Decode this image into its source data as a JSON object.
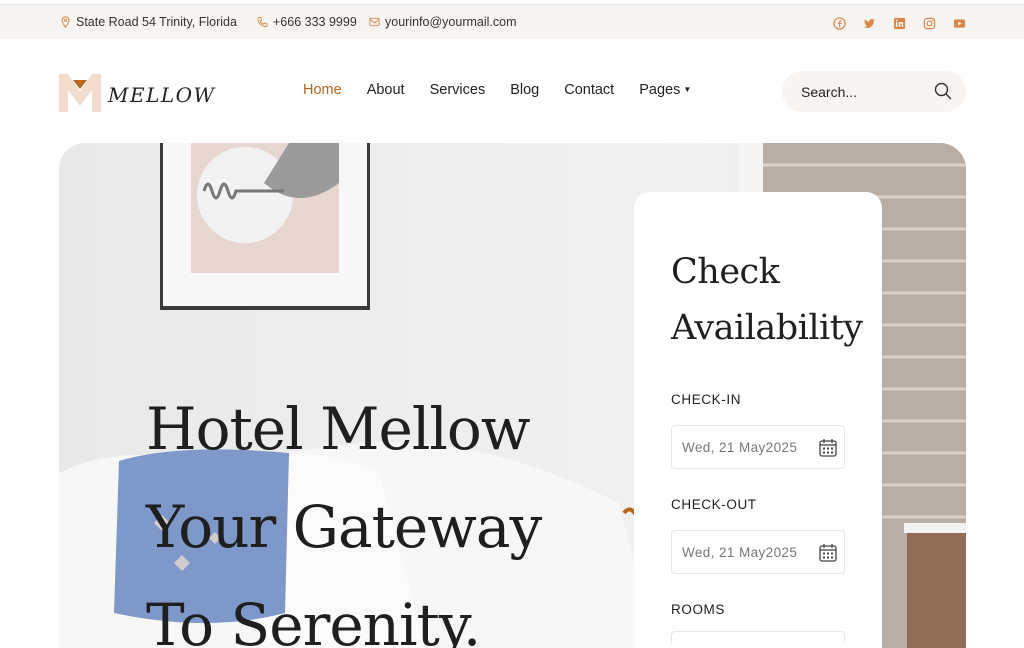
{
  "topbar": {
    "address": "State Road 54 Trinity, Florida",
    "phone": "+666 333 9999",
    "email": "yourinfo@yourmail.com",
    "socials": [
      "facebook-icon",
      "twitter-icon",
      "linkedin-icon",
      "instagram-icon",
      "youtube-icon"
    ],
    "accent": "#d9864a"
  },
  "header": {
    "logo_text": "MELLOW",
    "nav": [
      {
        "label": "Home",
        "active": true
      },
      {
        "label": "About"
      },
      {
        "label": "Services"
      },
      {
        "label": "Blog"
      },
      {
        "label": "Contact"
      },
      {
        "label": "Pages",
        "has_dropdown": true
      }
    ],
    "search_placeholder": "Search..."
  },
  "hero": {
    "title": "Hotel Mellow Your Gateway To Serenity."
  },
  "booking": {
    "title": "Check Availability",
    "checkin_label": "CHECK-IN",
    "checkin_value": "Wed, 21 May2025",
    "checkout_label": "CHECK-OUT",
    "checkout_value": "Wed, 21 May2025",
    "rooms_label": "ROOMS"
  },
  "colors": {
    "active_nav": "#b2641e",
    "topbar_bg": "#f8f4f1",
    "logo_peach": "#f3dccd"
  }
}
